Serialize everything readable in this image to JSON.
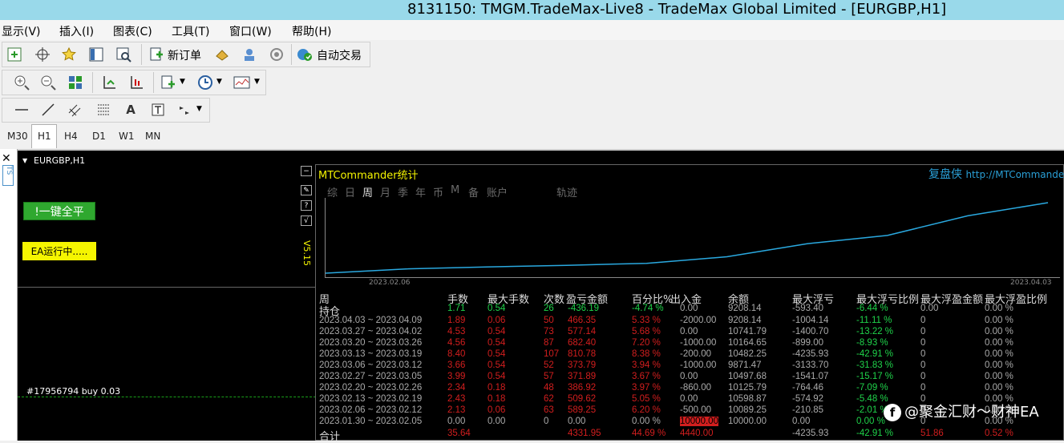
{
  "window": {
    "title": "8131150: TMGM.TradeMax-Live8 - TradeMax Global Limited - [EURGBP,H1]"
  },
  "menu": [
    "显示(V)",
    "插入(I)",
    "图表(C)",
    "工具(T)",
    "窗口(W)",
    "帮助(H)"
  ],
  "toolbar": {
    "new_order": "新订单",
    "auto_trading": "自动交易"
  },
  "timeframes": [
    "M30",
    "H1",
    "H4",
    "D1",
    "W1",
    "MN"
  ],
  "active_timeframe": "H1",
  "chart": {
    "symbol": "EURGBP,H1",
    "close_all_button": "!一键全平",
    "ea_status": "EA运行中.....",
    "ea_version": "V5.15",
    "order_label": "#17956794 buy 0.03"
  },
  "panel": {
    "title": "MTCommander统计",
    "brand": "复盘侠",
    "url": "http://MTCommander",
    "tabs": [
      "综",
      "日",
      "周",
      "月",
      "季",
      "年",
      "币",
      "M",
      "备",
      "账户",
      "轨迹"
    ],
    "active_tab": "周",
    "plot_start": "2023.02.06",
    "plot_end": "2023.04.03",
    "plot_series": [
      0.0,
      0.26,
      0.38,
      0.48,
      0.6,
      1.0,
      1.8,
      2.3,
      3.5,
      4.3
    ],
    "headers": [
      "周",
      "手数",
      "最大手数",
      "次数",
      "盈亏金额",
      "百分比%",
      "出入金",
      "余额",
      "最大浮亏",
      "最大浮亏比例",
      "最大浮盈金额",
      "最大浮盈比例"
    ],
    "hold_row": {
      "period": "持仓",
      "lots": "1.71",
      "max_lots": "0.54",
      "count": "26",
      "pnl": "-436.19",
      "pct": "-4.74 %",
      "flow": "0.00",
      "balance": "9208.14",
      "max_float_loss": "-593.40",
      "max_float_loss_pct": "-6.44 %",
      "max_float_profit": "0.00",
      "max_float_profit_pct": "0.00 %"
    },
    "rows": [
      {
        "period": "2023.04.03 ~ 2023.04.09",
        "lots": "1.89",
        "max_lots": "0.06",
        "count": "50",
        "pnl": "466.35",
        "pct": "5.33 %",
        "flow": "-2000.00",
        "balance": "9208.14",
        "max_float_loss": "-1004.14",
        "max_float_loss_pct": "-11.11 %",
        "max_float_profit": "0",
        "max_float_profit_pct": "0.00 %"
      },
      {
        "period": "2023.03.27 ~ 2023.04.02",
        "lots": "4.53",
        "max_lots": "0.54",
        "count": "73",
        "pnl": "577.14",
        "pct": "5.68 %",
        "flow": "0.00",
        "balance": "10741.79",
        "max_float_loss": "-1400.70",
        "max_float_loss_pct": "-13.22 %",
        "max_float_profit": "0",
        "max_float_profit_pct": "0.00 %"
      },
      {
        "period": "2023.03.20 ~ 2023.03.26",
        "lots": "4.56",
        "max_lots": "0.54",
        "count": "87",
        "pnl": "682.40",
        "pct": "7.20 %",
        "flow": "-1000.00",
        "balance": "10164.65",
        "max_float_loss": "-899.00",
        "max_float_loss_pct": "-8.93 %",
        "max_float_profit": "0",
        "max_float_profit_pct": "0.00 %"
      },
      {
        "period": "2023.03.13 ~ 2023.03.19",
        "lots": "8.40",
        "max_lots": "0.54",
        "count": "107",
        "pnl": "810.78",
        "pct": "8.38 %",
        "flow": "-200.00",
        "balance": "10482.25",
        "max_float_loss": "-4235.93",
        "max_float_loss_pct": "-42.91 %",
        "max_float_profit": "0",
        "max_float_profit_pct": "0.00 %"
      },
      {
        "period": "2023.03.06 ~ 2023.03.12",
        "lots": "3.66",
        "max_lots": "0.54",
        "count": "52",
        "pnl": "373.79",
        "pct": "3.94 %",
        "flow": "-1000.00",
        "balance": "9871.47",
        "max_float_loss": "-3133.70",
        "max_float_loss_pct": "-31.83 %",
        "max_float_profit": "0",
        "max_float_profit_pct": "0.00 %"
      },
      {
        "period": "2023.02.27 ~ 2023.03.05",
        "lots": "3.99",
        "max_lots": "0.54",
        "count": "57",
        "pnl": "371.89",
        "pct": "3.67 %",
        "flow": "0.00",
        "balance": "10497.68",
        "max_float_loss": "-1541.07",
        "max_float_loss_pct": "-15.17 %",
        "max_float_profit": "0",
        "max_float_profit_pct": "0.00 %"
      },
      {
        "period": "2023.02.20 ~ 2023.02.26",
        "lots": "2.34",
        "max_lots": "0.18",
        "count": "48",
        "pnl": "386.92",
        "pct": "3.97 %",
        "flow": "-860.00",
        "balance": "10125.79",
        "max_float_loss": "-764.46",
        "max_float_loss_pct": "-7.09 %",
        "max_float_profit": "0",
        "max_float_profit_pct": "0.00 %"
      },
      {
        "period": "2023.02.13 ~ 2023.02.19",
        "lots": "2.43",
        "max_lots": "0.18",
        "count": "62",
        "pnl": "509.62",
        "pct": "5.05 %",
        "flow": "0.00",
        "balance": "10598.87",
        "max_float_loss": "-574.92",
        "max_float_loss_pct": "-5.48 %",
        "max_float_profit": "0",
        "max_float_profit_pct": "0.00 %"
      },
      {
        "period": "2023.02.06 ~ 2023.02.12",
        "lots": "2.13",
        "max_lots": "0.06",
        "count": "63",
        "pnl": "589.25",
        "pct": "6.20 %",
        "flow": "-500.00",
        "balance": "10089.25",
        "max_float_loss": "-210.85",
        "max_float_loss_pct": "-2.01 %",
        "max_float_profit": "0",
        "max_float_profit_pct": "0.00 %"
      },
      {
        "period": "2023.01.30 ~ 2023.02.05",
        "lots": "0.00",
        "max_lots": "0.00",
        "count": "0",
        "pnl": "0.00",
        "pct": "0.00 %",
        "flow": "10000.00",
        "balance": "10000.00",
        "max_float_loss": "0.00",
        "max_float_loss_pct": "0.00 %",
        "max_float_profit": "0",
        "max_float_profit_pct": "0.00 %"
      }
    ],
    "total_row": {
      "period": "合计",
      "lots": "35.64",
      "pnl": "4331.95",
      "pct": "44.69 %",
      "flow": "4440.00",
      "max_float_loss": "-4235.93",
      "max_float_loss_pct": "-42.91 %",
      "max_float_profit": "51.86",
      "max_float_profit_pct": "0.52 %"
    }
  },
  "watermark": "@聚金汇财～财神EA"
}
